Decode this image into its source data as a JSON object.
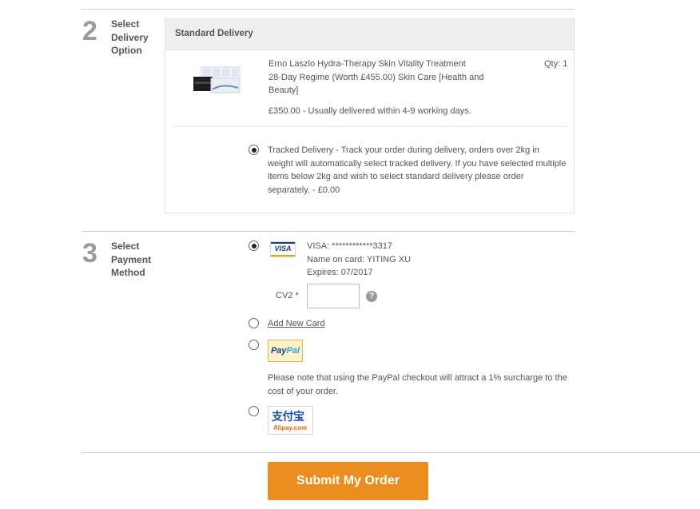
{
  "delivery_step": {
    "number": "2",
    "title_lines": [
      "Select",
      "Delivery",
      "Option"
    ],
    "section_header": "Standard Delivery",
    "product": {
      "name_lines": [
        "Erno Laszlo Hydra-Therapy Skin Vitality Treatment",
        "28-Day Regime (Worth £455.00) Skin Care [Health and",
        "Beauty]"
      ],
      "qty": "Qty: 1",
      "price_info": "£350.00 - Usually delivered within 4-9 working days."
    },
    "option": {
      "selected": true,
      "text_lines": [
        "Tracked Delivery - Track your order during delivery, orders over 2kg in",
        "weight will automatically select tracked delivery. If you have selected multiple",
        "items below 2kg and wish to select standard delivery please order",
        "separately. - £0.00"
      ]
    }
  },
  "payment_step": {
    "number": "3",
    "title_lines": [
      "Select",
      "Payment",
      "Method"
    ],
    "saved_card": {
      "selected": true,
      "brand_logo": "VISA",
      "number_line": "VISA: ************3317",
      "name_line": "Name on card: YITING XU",
      "expiry_line": "Expires: 07/2017",
      "cv2_label": "CV2 *",
      "cv2_value": "",
      "help_icon": "?"
    },
    "add_new_card": {
      "selected": false,
      "label": "Add New Card"
    },
    "paypal": {
      "selected": false,
      "logo_text_a": "Pay",
      "logo_text_b": "Pal",
      "note_lines": [
        "Please note that using the PayPal checkout will attract a 1% surcharge to the",
        "cost of your order."
      ]
    },
    "alipay": {
      "selected": false,
      "logo_cn": "支付宝",
      "logo_en": "Alipay.com"
    }
  },
  "submit_label": "Submit My Order",
  "colors": {
    "accent": "#eb8e1f",
    "step_number": "#9b9b9b",
    "header_bg": "#efefef"
  }
}
